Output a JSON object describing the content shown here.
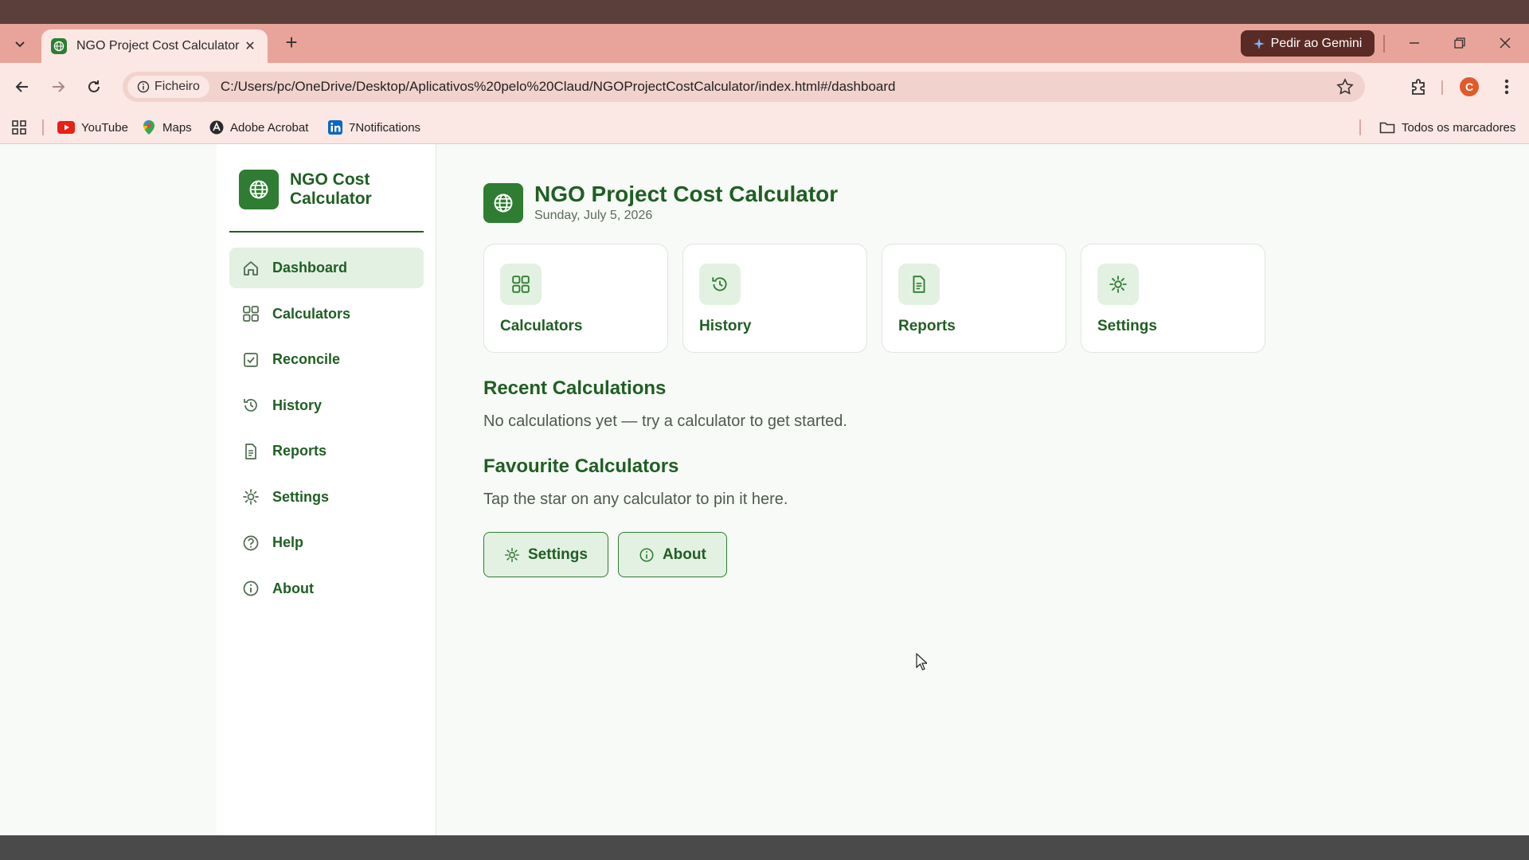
{
  "browser": {
    "tab_title": "NGO Project Cost Calculator",
    "gemini_label": "Pedir ao Gemini",
    "site_chip": "Ficheiro",
    "url": "C:/Users/pc/OneDrive/Desktop/Aplicativos%20pelo%20Claud/NGOProjectCostCalculator/index.html#/dashboard",
    "profile_initial": "C",
    "bookmarks": [
      {
        "label": "YouTube",
        "icon": "youtube-icon"
      },
      {
        "label": "Maps",
        "icon": "maps-icon"
      },
      {
        "label": "Adobe Acrobat",
        "icon": "acrobat-icon"
      },
      {
        "label": "7Notifications",
        "icon": "linkedin-icon"
      }
    ],
    "all_bookmarks_label": "Todos os marcadores"
  },
  "sidebar": {
    "brand": "NGO Cost Calculator",
    "items": [
      {
        "label": "Dashboard",
        "icon": "home-icon",
        "active": true
      },
      {
        "label": "Calculators",
        "icon": "grid-icon"
      },
      {
        "label": "Reconcile",
        "icon": "checkbox-icon"
      },
      {
        "label": "History",
        "icon": "history-icon"
      },
      {
        "label": "Reports",
        "icon": "document-icon"
      },
      {
        "label": "Settings",
        "icon": "gear-icon"
      },
      {
        "label": "Help",
        "icon": "help-icon"
      },
      {
        "label": "About",
        "icon": "info-icon"
      }
    ]
  },
  "main": {
    "title": "NGO Project Cost Calculator",
    "date": "Sunday, July 5, 2026",
    "cards": [
      {
        "label": "Calculators",
        "icon": "grid-icon"
      },
      {
        "label": "History",
        "icon": "history-icon"
      },
      {
        "label": "Reports",
        "icon": "document-icon"
      },
      {
        "label": "Settings",
        "icon": "gear-icon"
      }
    ],
    "recent_title": "Recent Calculations",
    "recent_empty": "No calculations yet — try a calculator to get started.",
    "favourites_title": "Favourite Calculators",
    "favourites_empty": "Tap the star on any calculator to pin it here.",
    "buttons": [
      {
        "label": "Settings",
        "icon": "gear-icon"
      },
      {
        "label": "About",
        "icon": "info-icon"
      }
    ]
  },
  "colors": {
    "accent": "#2e7d32",
    "accent_dark": "#1f5f23",
    "accent_light": "#e3f1e3",
    "tabbar": "#e8a49a"
  }
}
